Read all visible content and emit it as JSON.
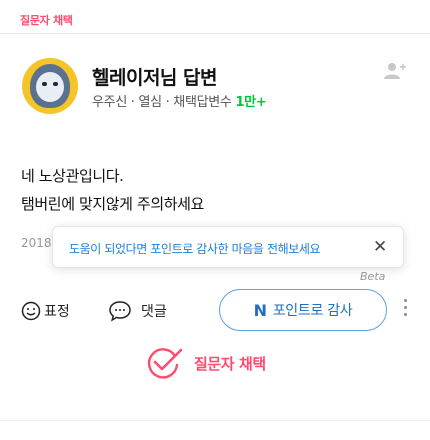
{
  "badge": "질문자 채택",
  "profile": {
    "name": "헬레이저님 답변",
    "meta_prefix": "우주신 · 열심 · 채택답변수 ",
    "answer_count": "1만+"
  },
  "answer": {
    "line1": "네 노상관입니다.",
    "line2": "탬버린에 맞지않게 주의하세요"
  },
  "date": "2018",
  "tooltip": {
    "text": "도움이 되었다면 포인트로 감사한 마음을 전해보세요",
    "close": "✕"
  },
  "actions": {
    "emotion_label": "표정",
    "comment_label": "댓글",
    "beta": "Beta",
    "donate_icon": "N",
    "donate_label": "포인트로 감사"
  },
  "adopt_label": "질문자 채택",
  "colors": {
    "accent_pink": "#ff4b6e",
    "brand_green": "#00c73c",
    "link_blue": "#1f6fc0"
  }
}
